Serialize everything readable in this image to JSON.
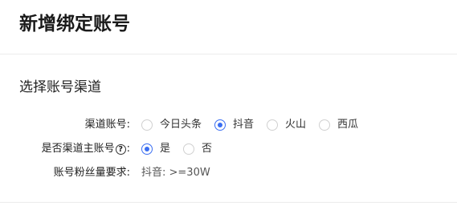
{
  "header": {
    "title": "新增绑定账号"
  },
  "section": {
    "title": "选择账号渠道"
  },
  "form": {
    "channel": {
      "label": "渠道账号:",
      "options": [
        {
          "label": "今日头条",
          "checked": false
        },
        {
          "label": "抖音",
          "checked": true
        },
        {
          "label": "火山",
          "checked": false
        },
        {
          "label": "西瓜",
          "checked": false
        }
      ]
    },
    "main_account": {
      "label_prefix": "是否渠道主账号",
      "help_glyph": "?",
      "label_suffix": ":",
      "options": [
        {
          "label": "是",
          "checked": true
        },
        {
          "label": "否",
          "checked": false
        }
      ]
    },
    "fans_requirement": {
      "label": "账号粉丝量要求:",
      "value": "抖音: >=30W"
    }
  },
  "colors": {
    "accent": "#3a6ef2",
    "divider": "#ececec"
  },
  "icons": {
    "help": "question-circle-icon"
  }
}
